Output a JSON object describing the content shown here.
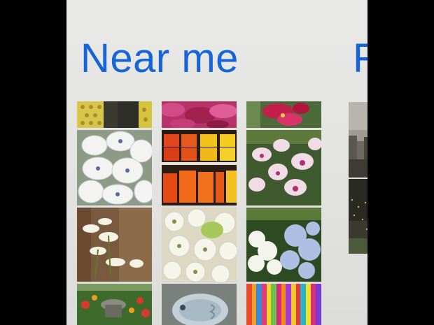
{
  "panorama": {
    "sections": [
      {
        "title": "Near me"
      },
      {
        "title": "F"
      }
    ]
  },
  "photos": {
    "near_me": [
      "lace-fabric-photo",
      "pink-flowers-photo",
      "red-orchid-photo",
      "white-clematis-photo",
      "orange-yellow-pots-photo",
      "pink-orchids-photo",
      "white-lilies-photo",
      "white-star-flowers-photo",
      "hydrangea-photo",
      "garden-planter-photo",
      "stone-fish-photo",
      "colored-sticks-photo"
    ],
    "next_section": [
      "city-skyline-photo",
      "city-night-photo"
    ]
  }
}
